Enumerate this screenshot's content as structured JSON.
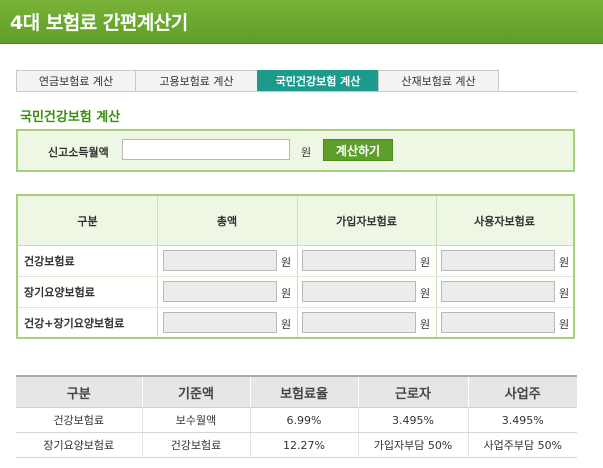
{
  "header": {
    "title": "4대 보험료 간편계산기"
  },
  "tabs": [
    {
      "label": "연금보험료 계산",
      "active": false
    },
    {
      "label": "고용보험료 계산",
      "active": false
    },
    {
      "label": "국민건강보험 계산",
      "active": true
    },
    {
      "label": "산재보험료 계산",
      "active": false
    }
  ],
  "section": {
    "title": "국민건강보험 계산"
  },
  "search": {
    "label": "신고소득월액",
    "value": "",
    "unit": "원",
    "button_label": "계산하기"
  },
  "calc_table": {
    "headers": [
      "구분",
      "총액",
      "가입자보험료",
      "사용자보험료"
    ],
    "unit": "원",
    "rows": [
      {
        "label": "건강보험료"
      },
      {
        "label": "장기요양보험료"
      },
      {
        "label": "건강+장기요양보험료"
      }
    ]
  },
  "rate_table": {
    "headers": [
      "구분",
      "기준액",
      "보험료율",
      "근로자",
      "사업주"
    ],
    "rows": [
      [
        "건강보험료",
        "보수월액",
        "6.99%",
        "3.495%",
        "3.495%"
      ],
      [
        "장기요양보험료",
        "건강보험료",
        "12.27%",
        "가입자부담 50%",
        "사업주부담 50%"
      ]
    ]
  },
  "colors": {
    "header_green": "#6aa82f",
    "active_tab": "#1e9a8c",
    "section_title": "#3a8e0e",
    "panel_border": "#a6cf79",
    "panel_bg": "#eef6e4"
  }
}
